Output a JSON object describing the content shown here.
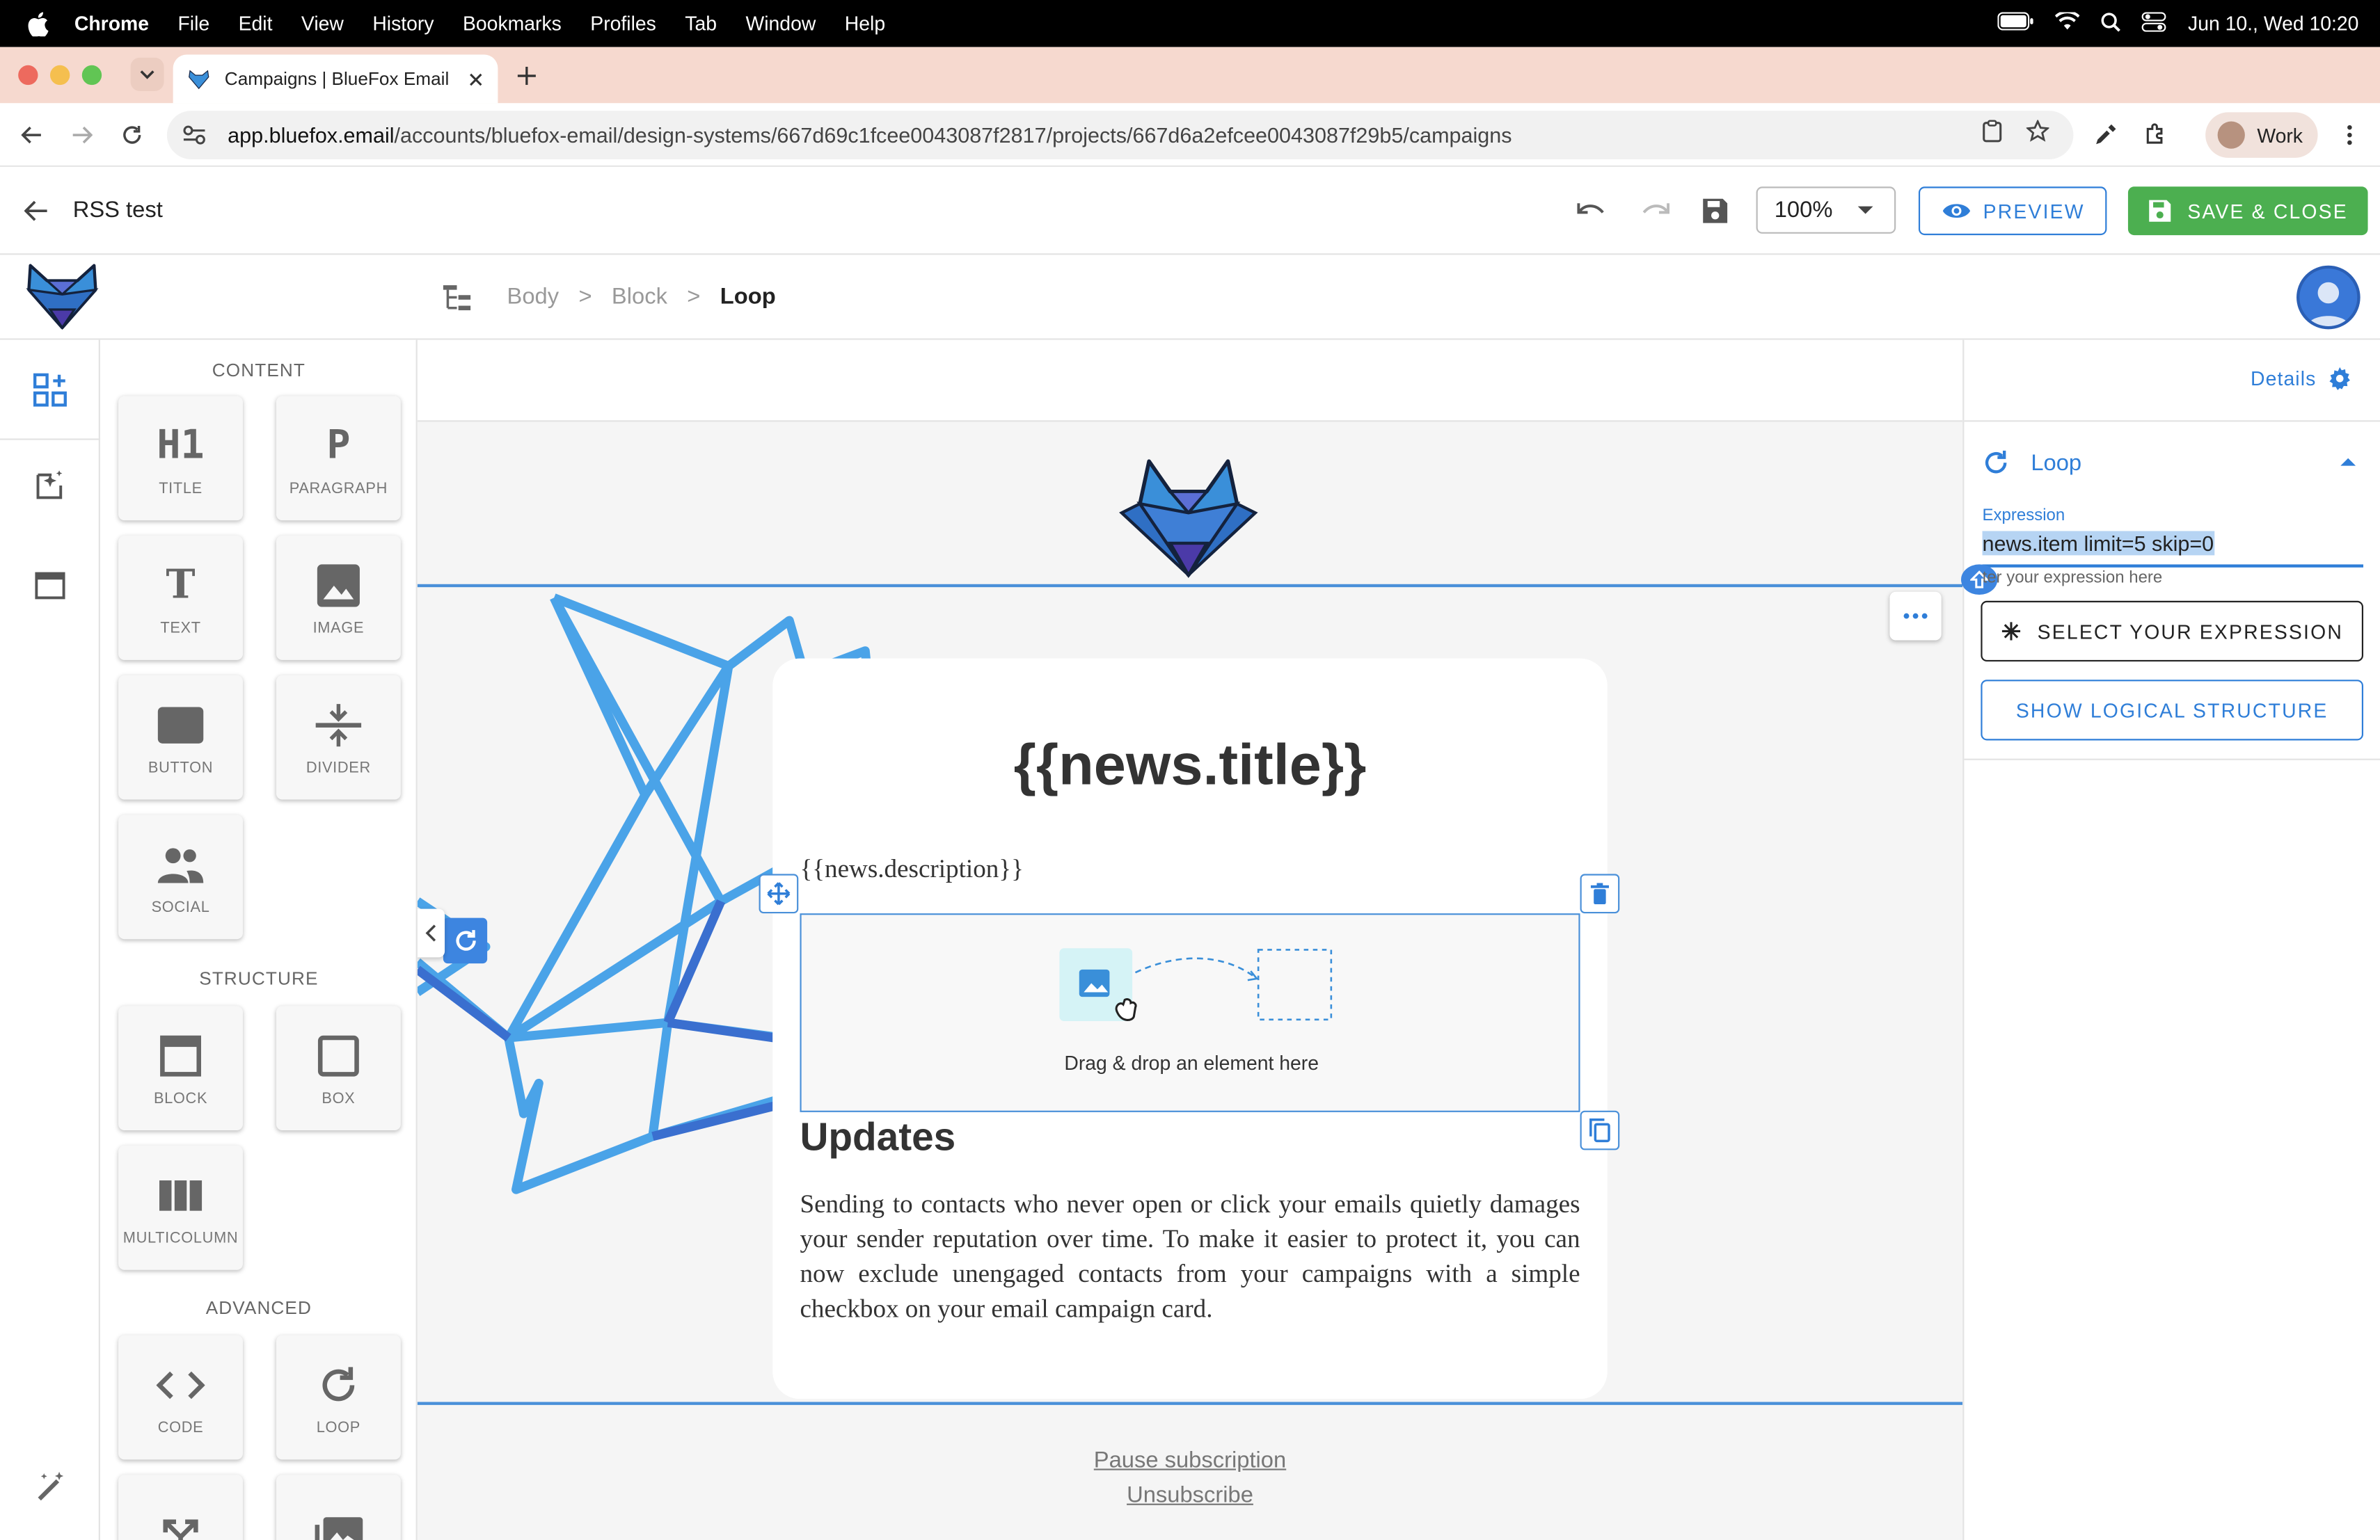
{
  "menubar": {
    "app": "Chrome",
    "items": [
      "File",
      "Edit",
      "View",
      "History",
      "Bookmarks",
      "Profiles",
      "Tab",
      "Window",
      "Help"
    ],
    "clock": "Jun 10., Wed  10:20"
  },
  "browser": {
    "tab_title": "Campaigns | BlueFox Email",
    "url_host": "app.bluefox.email",
    "url_path": "/accounts/bluefox-email/design-systems/667d69c1fcee0043087f2817/projects/667d6a2efcee0043087f29b5/campaigns",
    "profile_label": "Work"
  },
  "header": {
    "doc_name": "RSS test",
    "zoom": "100%",
    "preview_label": "PREVIEW",
    "save_close_label": "SAVE & CLOSE"
  },
  "breadcrumb": {
    "items": [
      "Body",
      "Block",
      "Loop"
    ],
    "separator": ">"
  },
  "palette": {
    "sections": {
      "content": "CONTENT",
      "structure": "STRUCTURE",
      "advanced": "ADVANCED"
    },
    "content": [
      {
        "label": "TITLE",
        "glyph": "H1",
        "icon": "title-icon"
      },
      {
        "label": "PARAGRAPH",
        "glyph": "P",
        "icon": "paragraph-icon"
      },
      {
        "label": "TEXT",
        "glyph": "T",
        "icon": "text-icon"
      },
      {
        "label": "IMAGE",
        "icon": "image-icon"
      },
      {
        "label": "BUTTON",
        "icon": "button-icon"
      },
      {
        "label": "DIVIDER",
        "icon": "divider-icon"
      },
      {
        "label": "SOCIAL",
        "icon": "social-icon"
      }
    ],
    "structure": [
      {
        "label": "BLOCK",
        "icon": "block-icon"
      },
      {
        "label": "BOX",
        "icon": "box-icon"
      },
      {
        "label": "MULTICOLUMN",
        "icon": "multicolumn-icon"
      }
    ],
    "advanced": [
      {
        "label": "CODE",
        "icon": "code-icon"
      },
      {
        "label": "LOOP",
        "icon": "loop-icon"
      }
    ]
  },
  "canvas": {
    "news_title": "{{news.title}}",
    "news_description": "{{news.description}}",
    "dropzone_label": "Drag & drop an element here",
    "updates_heading": "Updates",
    "updates_body": "Sending to contacts who never open or click your emails quietly damages your sender reputation over time. To make it easier to protect it, you can now exclude unengaged contacts from your campaigns with a simple checkbox on your email campaign card.",
    "pause_link": "Pause subscription",
    "unsubscribe_link": "Unsubscribe"
  },
  "panel": {
    "details_label": "Details",
    "section_title": "Loop",
    "expression_label": "Expression",
    "expression_value": "news.item limit=5 skip=0",
    "expression_hint": "ter your expression here",
    "select_expression_label": "SELECT YOUR EXPRESSION",
    "show_structure_label": "SHOW LOGICAL STRUCTURE"
  },
  "colors": {
    "accent": "#2f7ed8",
    "save_green": "#4caf50",
    "tabstrip": "#f6d9cf",
    "selection_line": "#4a90d9"
  }
}
